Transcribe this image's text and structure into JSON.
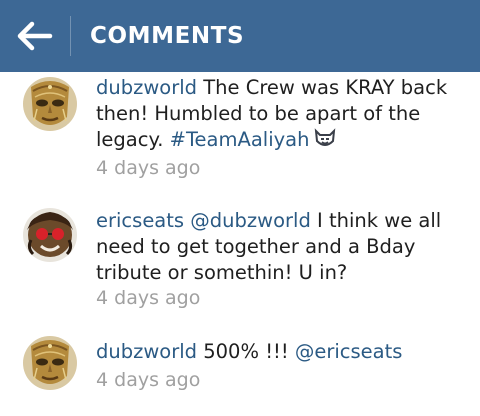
{
  "header": {
    "title": "COMMENTS",
    "background": "#3d6895"
  },
  "comments": [
    {
      "username": "dubzworld",
      "text_before": " The Crew was KRAY back then! Humbled to be apart of the legacy. ",
      "hashtag": "#TeamAaliyah",
      "mention": "",
      "text_after": "",
      "emoji": "party-face-emoji",
      "time": "4 days ago",
      "avatar": "golden-mask-avatar"
    },
    {
      "username": "ericseats",
      "text_before": " ",
      "mention": "@dubzworld",
      "text_after": " I think we all need to get together and a Bday tribute or somethin! U in?",
      "hashtag": "",
      "time": "4 days ago",
      "avatar": "red-glasses-avatar"
    },
    {
      "username": "dubzworld",
      "text_before": " 500% !!! ",
      "mention": "@ericseats",
      "text_after": "",
      "hashtag": "",
      "time": "4 days ago",
      "avatar": "golden-mask-avatar"
    }
  ],
  "colors": {
    "link": "#2b5a84",
    "timestamp": "#a0a0a0",
    "text": "#1f1f1f"
  }
}
